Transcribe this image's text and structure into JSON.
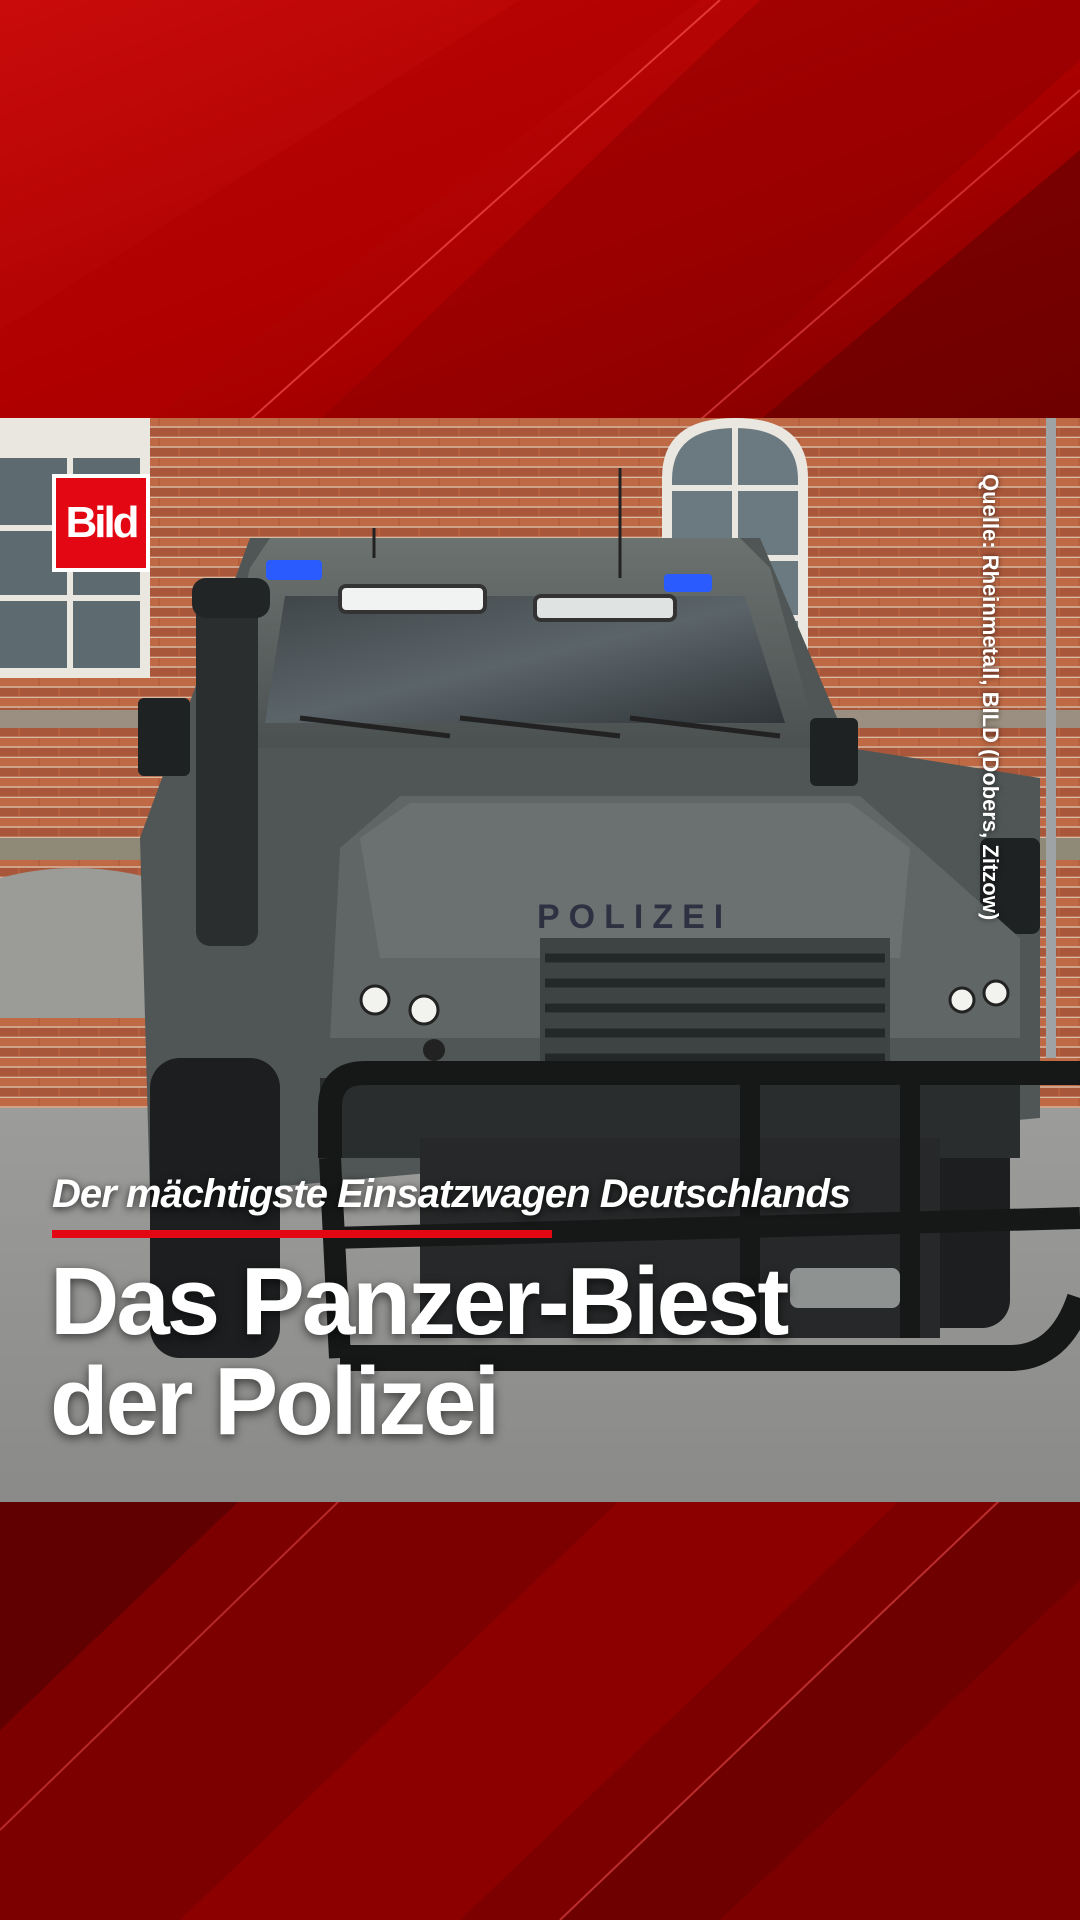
{
  "brand": {
    "logo_text": "Bild",
    "accent_color": "#e30613"
  },
  "image": {
    "source_credit": "Quelle: Rheinmetall, BILD (Dobers, Zitzow)",
    "vehicle_label": "POLIZEI"
  },
  "story": {
    "kicker": "Der mächtigste Einsatzwagen Deutschlands",
    "headline_line1": "Das Panzer-Biest",
    "headline_line2": "der Polizei"
  },
  "colors": {
    "background_red": "#a00000",
    "background_dark_red": "#6e0000",
    "vehicle_gray": "#5d6462",
    "brick": "#b5603e"
  }
}
